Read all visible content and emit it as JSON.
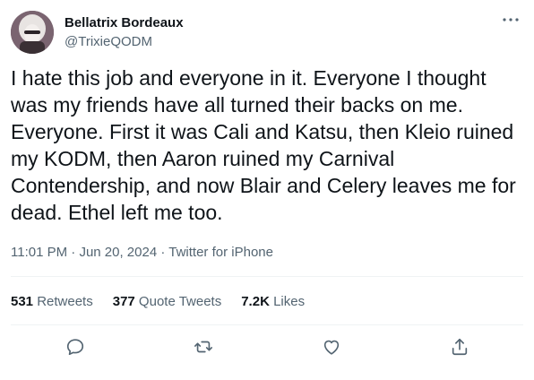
{
  "author": {
    "display_name": "Bellatrix Bordeaux",
    "handle": "@TrixieQODM",
    "avatar_icon": "avatar-image"
  },
  "tweet": {
    "text": "I hate this job and everyone in it. Everyone I thought was my friends have all turned their backs on me. Everyone. First it was Cali and Katsu, then Kleio ruined my KODM, then Aaron ruined my Carnival Contendership, and now Blair and Celery leaves me for dead. Ethel left me too.",
    "time": "11:01 PM",
    "separator": " · ",
    "date": "Jun 20, 2024",
    "source": "Twitter for iPhone"
  },
  "stats": {
    "retweets_count": "531",
    "retweets_label": " Retweets",
    "quotes_count": "377",
    "quotes_label": " Quote Tweets",
    "likes_count": "7.2K",
    "likes_label": " Likes"
  },
  "actions": {
    "reply_icon": "reply-icon",
    "retweet_icon": "retweet-icon",
    "like_icon": "heart-icon",
    "share_icon": "share-icon"
  },
  "colors": {
    "text_primary": "#0f1419",
    "text_secondary": "#536471",
    "divider": "#eff3f4"
  }
}
